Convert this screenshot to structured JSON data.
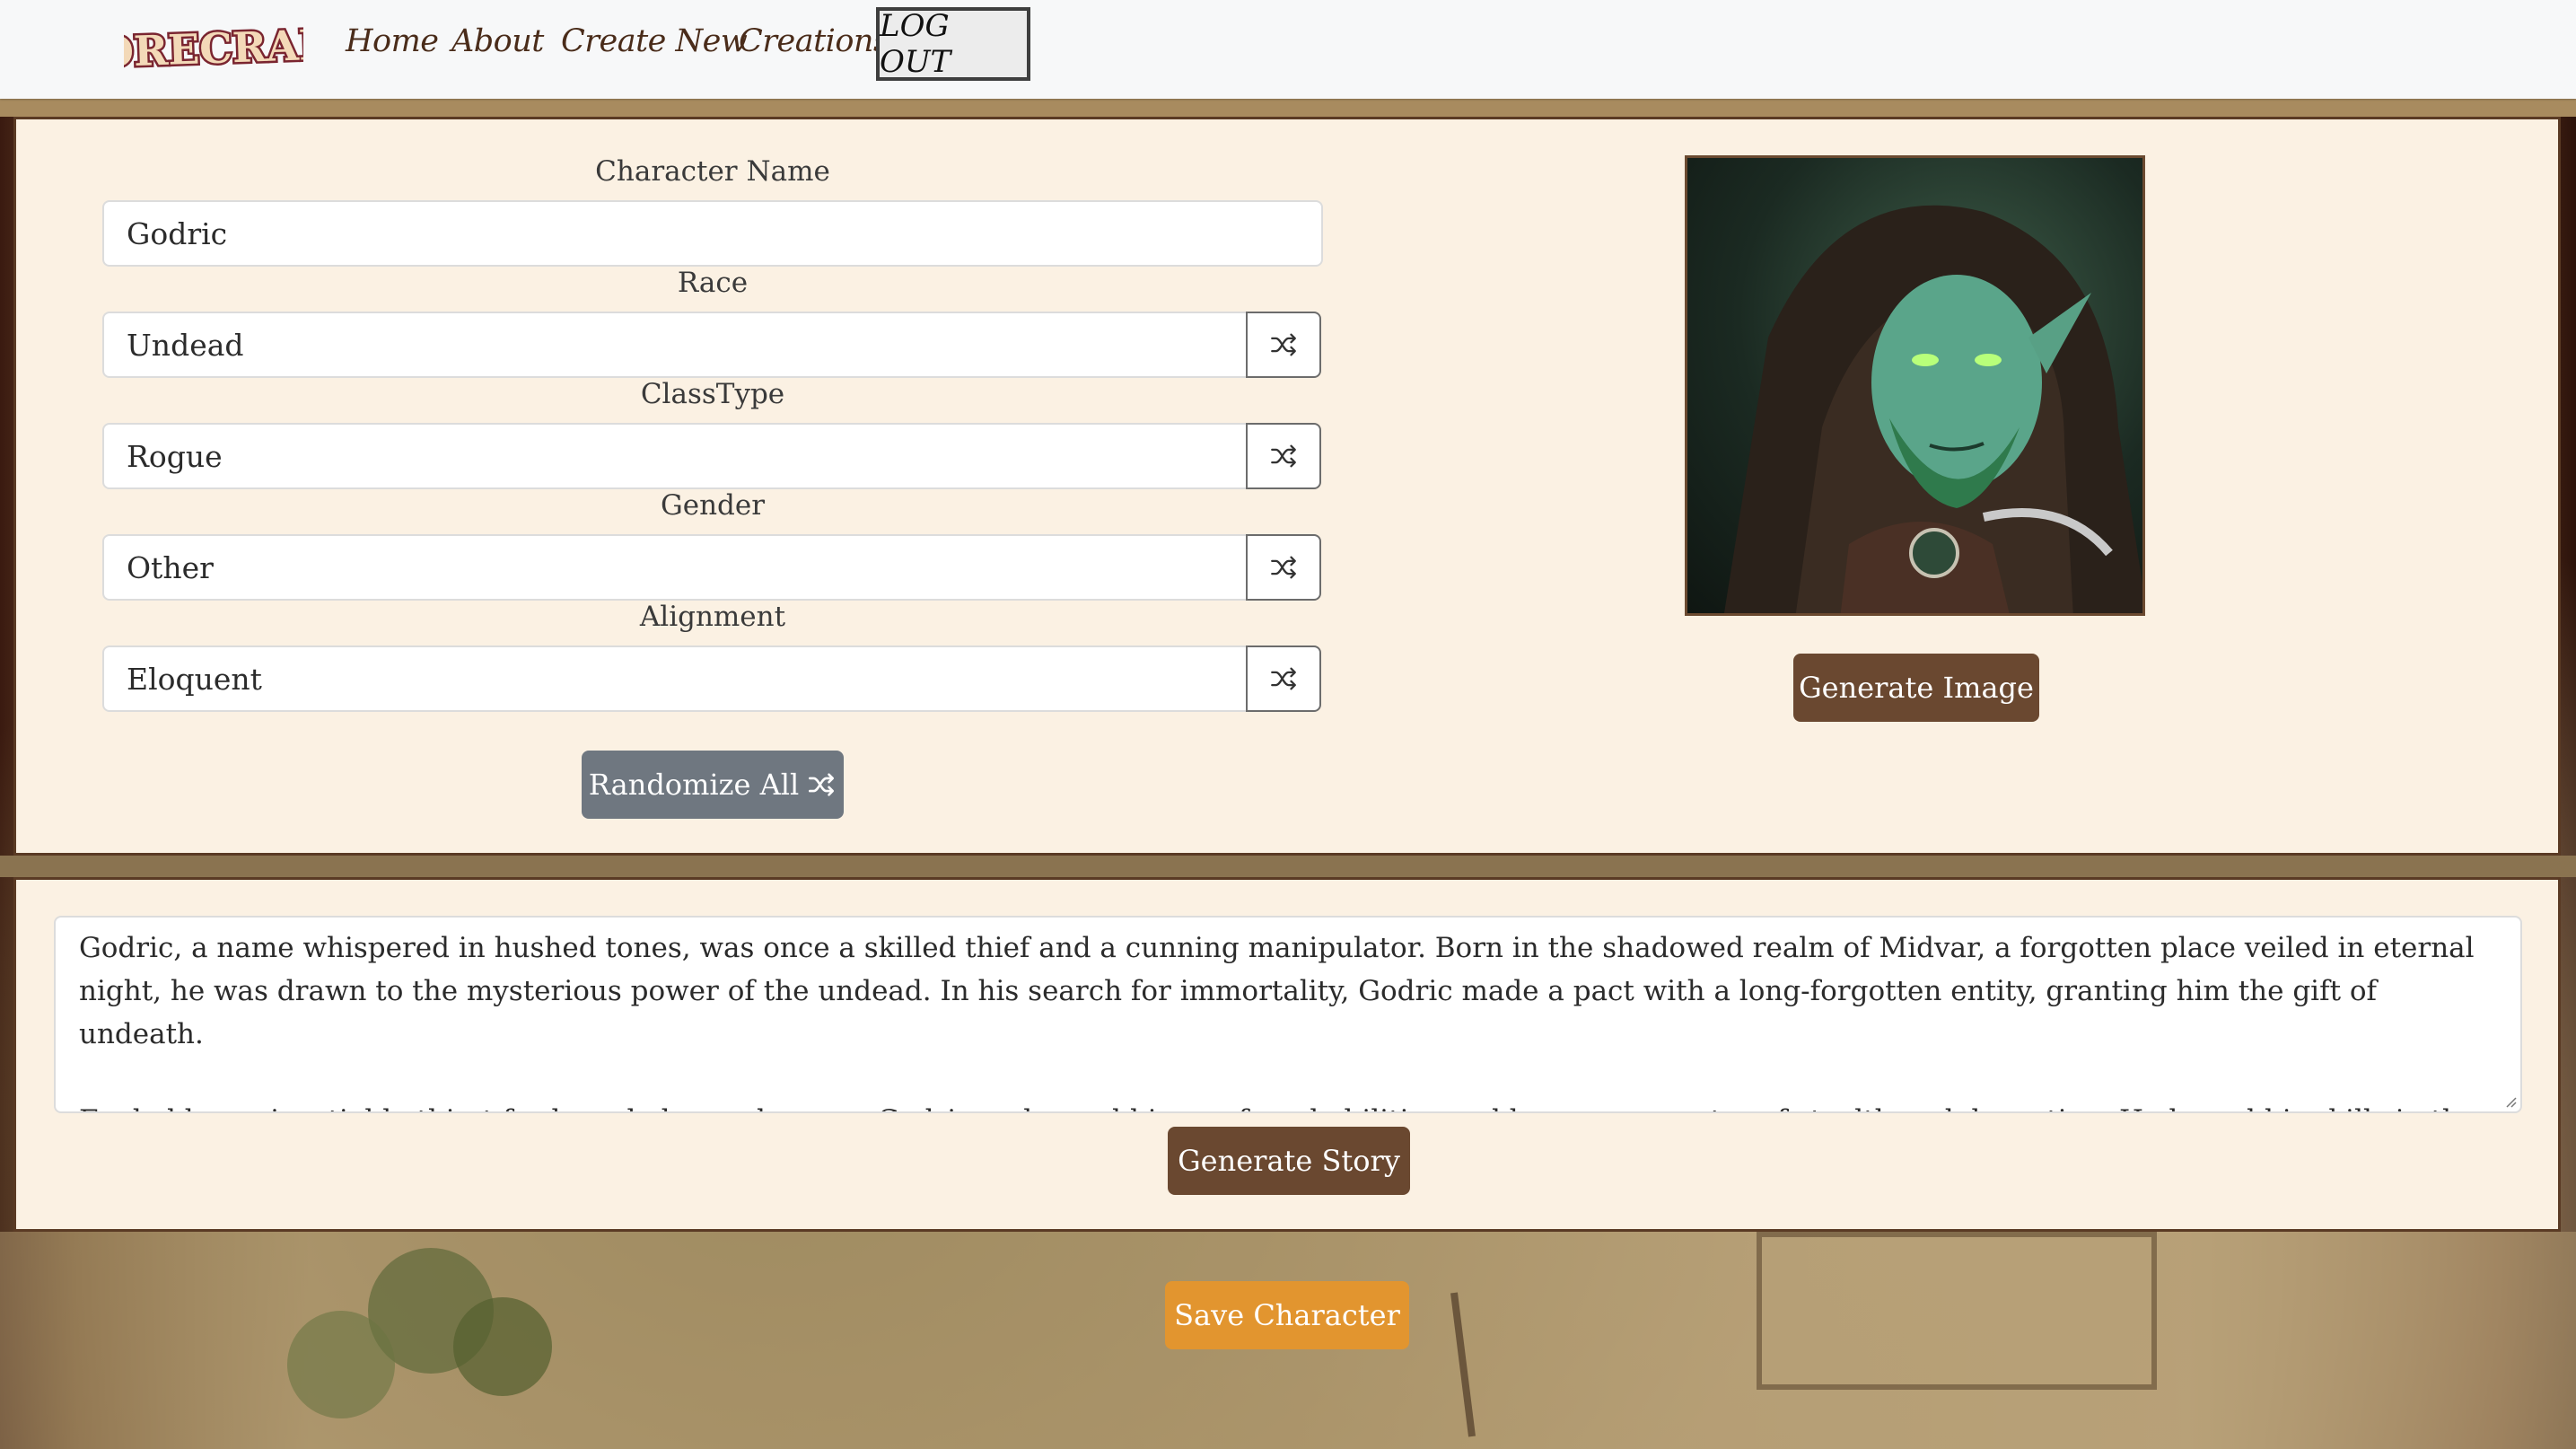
{
  "nav": {
    "logo_text": "LORECRAFT",
    "links": [
      "Home",
      "About",
      "Create New",
      "Creations"
    ],
    "logout_label": "LOG OUT"
  },
  "form": {
    "fields": [
      {
        "label": "Character Name",
        "value": "Godric",
        "randomizable": false
      },
      {
        "label": "Race",
        "value": "Undead",
        "randomizable": true
      },
      {
        "label": "ClassType",
        "value": "Rogue",
        "randomizable": true
      },
      {
        "label": "Gender",
        "value": "Other",
        "randomizable": true
      },
      {
        "label": "Alignment",
        "value": "Eloquent",
        "randomizable": true
      }
    ],
    "randomize_all_label": "Randomize All"
  },
  "image": {
    "generate_label": "Generate Image"
  },
  "story": {
    "paragraphs": [
      "Godric, a name whispered in hushed tones, was once a skilled thief and a cunning manipulator. Born in the shadowed realm of Midvar, a forgotten place veiled in eternal night, he was drawn to the mysterious power of the undead. In his search for immortality, Godric made a pact with a long-forgotten entity, granting him the gift of undeath.",
      "Fueled by an insatiable thirst for knowledge and power, Godric embraced his newfound abilities and became a master of stealth and deception. He honed his skills in the dark corners of Midvar, their secrets and legends guided him forward in his quest."
    ],
    "generate_label": "Generate Story"
  },
  "save_label": "Save Character",
  "colors": {
    "panel_bg": "#fbf1e3",
    "brown_button": "#6a4830",
    "gray_button": "#6f7780",
    "save_button": "#e2952f",
    "nav_text": "#4a2c1a"
  }
}
